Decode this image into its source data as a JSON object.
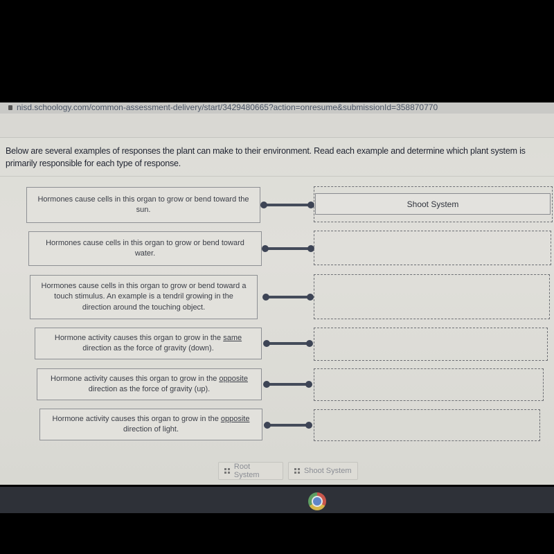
{
  "browser": {
    "url": "nisd.schoology.com/common-assessment-delivery/start/3429480665?action=onresume&submissionId=358870770"
  },
  "question": {
    "prompt": "Below are several examples of responses the plant can make to their environment.  Read each example and determine which plant system is primarily responsible for each type of response."
  },
  "matching": {
    "items": [
      {
        "pre": "Hormones cause cells in this organ to grow or bend toward the sun.",
        "emph": "",
        "post": "",
        "answer": "Shoot System"
      },
      {
        "pre": "Hormones cause cells in this organ to grow or bend toward water.",
        "emph": "",
        "post": "",
        "answer": ""
      },
      {
        "pre": "Hormones cause cells in this organ to grow or bend toward a touch stimulus.  An example is a tendril growing in the direction around the touching object.",
        "emph": "",
        "post": "",
        "answer": ""
      },
      {
        "pre": "Hormone activity causes this organ to grow in the ",
        "emph": "same",
        "post": " direction as the force of gravity (down).",
        "answer": ""
      },
      {
        "pre": "Hormone activity causes this organ to grow in the ",
        "emph": "opposite",
        "post": " direction as the force of gravity (up).",
        "answer": ""
      },
      {
        "pre": "Hormone activity causes this organ to grow in the ",
        "emph": "opposite",
        "post": " direction of light.",
        "answer": ""
      }
    ]
  },
  "answer_bank": [
    {
      "label": "Root System",
      "icon": "drag-handle-icon"
    },
    {
      "label": "Shoot System",
      "icon": "drag-handle-icon"
    }
  ],
  "taskbar": {
    "apps": [
      {
        "name": "Chrome",
        "icon": "chrome-icon"
      }
    ]
  }
}
